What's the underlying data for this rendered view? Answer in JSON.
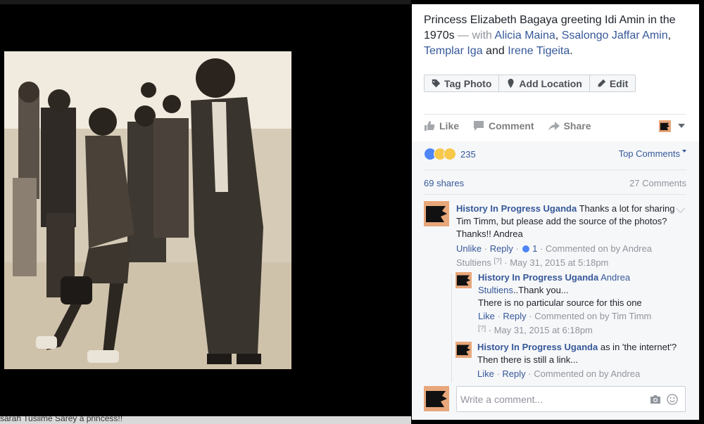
{
  "background_caption": "sarah Tusiime Sarey a princess!!",
  "post": {
    "title": "Princess Elizabeth Bagaya greeting Idi Amin in the 1970s",
    "with_word": "— with",
    "tagged": [
      "Alicia Maina",
      "Ssalongo Jaffar Amin",
      "Templar Iga",
      "Irene Tigeita"
    ],
    "sep_comma": ",",
    "sep_and": "and",
    "period": "."
  },
  "photo_buttons": {
    "tag": "Tag Photo",
    "location": "Add Location",
    "edit": "Edit"
  },
  "actions": {
    "like": "Like",
    "comment": "Comment",
    "share": "Share"
  },
  "reactions": {
    "count": "235",
    "types": [
      "like",
      "wow",
      "haha"
    ]
  },
  "sort_label": "Top Comments",
  "shares_label": "69 shares",
  "comments_label": "27 Comments",
  "comments": [
    {
      "author": "History In Progress Uganda",
      "text": "Thanks a lot for sharing Tim Timm, but please add the source of the photos? Thanks!! Andrea",
      "unlike": "Unlike",
      "reply": "Reply",
      "like_count": "1",
      "commented_on": "Commented on by Andrea Stultiens",
      "footnote": "[?]",
      "date": "May 31, 2015 at 5:18pm"
    },
    {
      "author": "History In Progress Uganda",
      "mention": "Andrea Stultiens",
      "text_line1": "..Thank you...",
      "text_line2": "There is no particular source for this one",
      "like": "Like",
      "reply": "Reply",
      "commented_on": "Commented on by Tim Timm",
      "footnote": "[?]",
      "date": "May 31, 2015 at 6:18pm"
    },
    {
      "author": "History In Progress Uganda",
      "text": "as in 'the internet'? Then there is still a link...",
      "like": "Like",
      "reply": "Reply",
      "commented_on": "Commented on by Andrea"
    }
  ],
  "composer": {
    "placeholder": "Write a comment..."
  },
  "colors": {
    "link": "#365899",
    "panel_bg": "#ffffff",
    "comment_area_bg": "#f6f7f9",
    "page_avatar_bg": "#e8a77a"
  },
  "icons": [
    "tag-icon",
    "location-pin-icon",
    "pencil-icon",
    "thumbs-up-icon",
    "comment-bubble-icon",
    "share-arrow-icon",
    "camera-icon",
    "smiley-icon",
    "chevron-down-icon"
  ]
}
